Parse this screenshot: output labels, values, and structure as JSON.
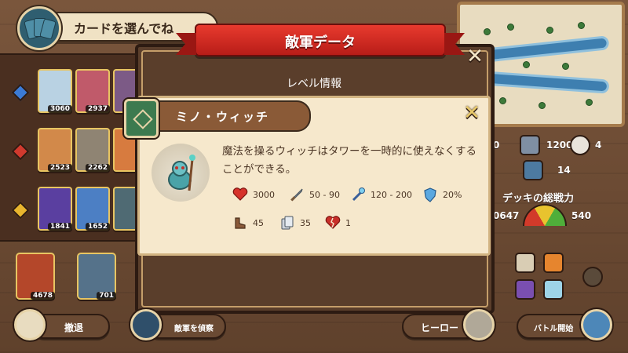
{
  "header": {
    "title": "カードを選んでね"
  },
  "popup": {
    "banner_title": "敵軍データ",
    "level_info": "レベル情報",
    "enemy": {
      "name": "ミノ・ウィッチ",
      "description": "魔法を操るウィッチはタワーを一時的に使えなくすることができる。",
      "stats": [
        {
          "icon": "heart-icon",
          "value": "3000"
        },
        {
          "icon": "sword-icon",
          "value": "50 - 90"
        },
        {
          "icon": "magic-staff-icon",
          "value": "120 - 200"
        },
        {
          "icon": "shield-icon",
          "value": "20%"
        },
        {
          "icon": "boot-speed-icon",
          "value": "45"
        },
        {
          "icon": "card-cost-icon",
          "value": "35"
        },
        {
          "icon": "broken-heart-icon",
          "value": "1"
        }
      ]
    }
  },
  "left_panel": {
    "row1_values": [
      "3060",
      "2937"
    ],
    "row2_values": [
      "2523",
      "2262"
    ],
    "row3_values": [
      "1841",
      "1652"
    ]
  },
  "bottom_cards": [
    "4678",
    "701"
  ],
  "right_panel": {
    "stat_a": "0",
    "stat_b": "1200",
    "stat_c": "4",
    "stat_d": "14",
    "deck_power_label": "デッキの総戦力",
    "deck_power_left": "0647",
    "deck_power_right": "540"
  },
  "buttons": {
    "retreat": "撤退",
    "scout": "敵軍を偵察",
    "hero": "ヒーロー",
    "start_battle": "バトル開始"
  },
  "colors": {
    "banner_red": "#d62a22",
    "card_bg": "#f6e8cc",
    "wood": "#6b4a33"
  }
}
